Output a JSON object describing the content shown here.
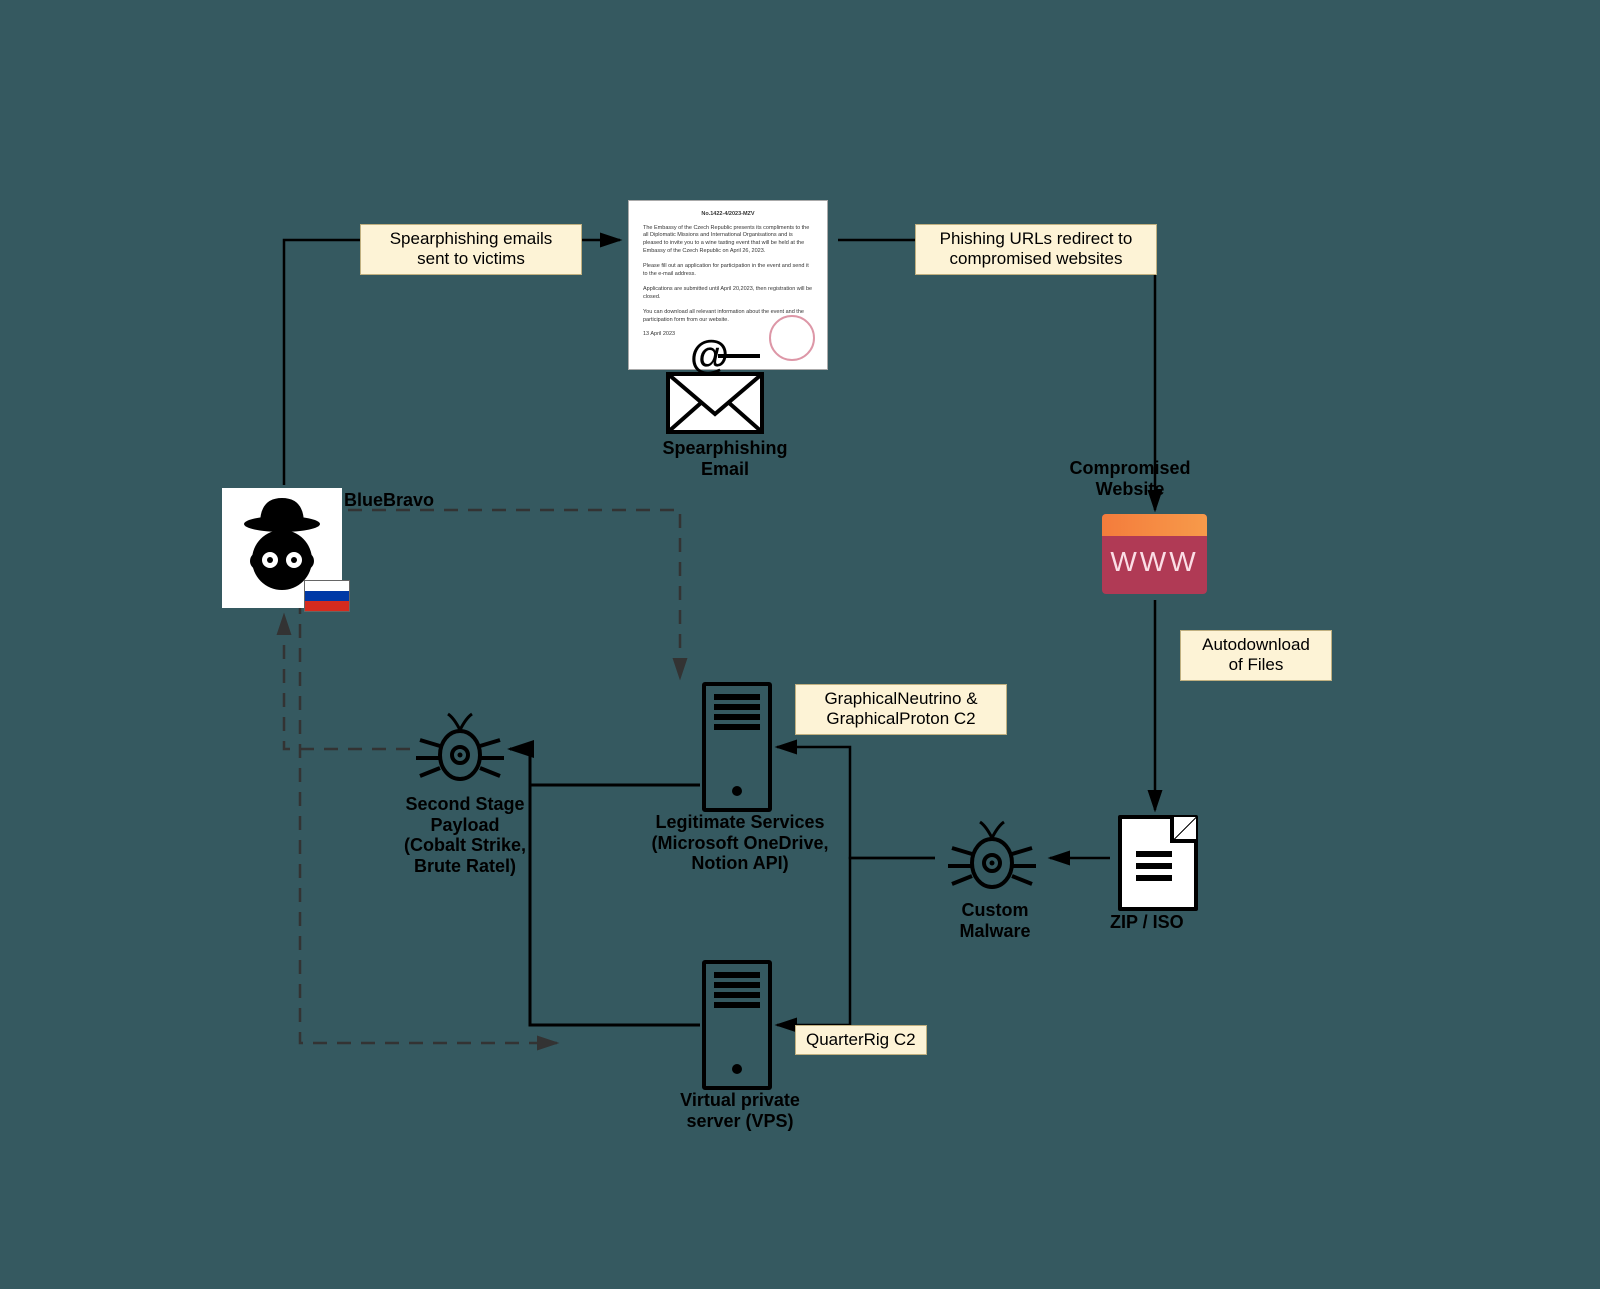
{
  "labels": {
    "spearphish_sent": "Spearphishing emails\nsent to victims",
    "phish_redirect": "Phishing URLs redirect to\ncompromised websites",
    "autodownload": "Autodownload\nof Files",
    "c2_1": "GraphicalNeutrino &\nGraphicalProton C2",
    "c2_2": "QuarterRig C2"
  },
  "nodes": {
    "actor": "BlueBravo",
    "email": "Spearphishing\nEmail",
    "website": "Compromised\nWebsite",
    "zip": "ZIP / ISO",
    "custom_malware": "Custom\nMalware",
    "legit": "Legitimate Services\n(Microsoft OneDrive,\nNotion API)",
    "vps": "Virtual private\nserver (VPS)",
    "payload": "Second Stage\nPayload\n(Cobalt Strike,\nBrute Ratel)"
  },
  "www_text": "WWW",
  "doc": {
    "header": "No.1422-4/2023-MZV",
    "body": "The Embassy of the Czech Republic presents its compliments to the all Diplomatic Missions and International Organisations and is pleased to invite you to a wine tasting event that will be held at the Embassy of the Czech Republic on April 26, 2023.\n\nPlease fill out an application for participation in the event and send it to the e-mail address.\n\nApplications are submitted until April 20,2023, then registration will be closed.\n\nYou can download all relevant information about the event and the participation form from our website.",
    "date": "13 April 2023"
  }
}
